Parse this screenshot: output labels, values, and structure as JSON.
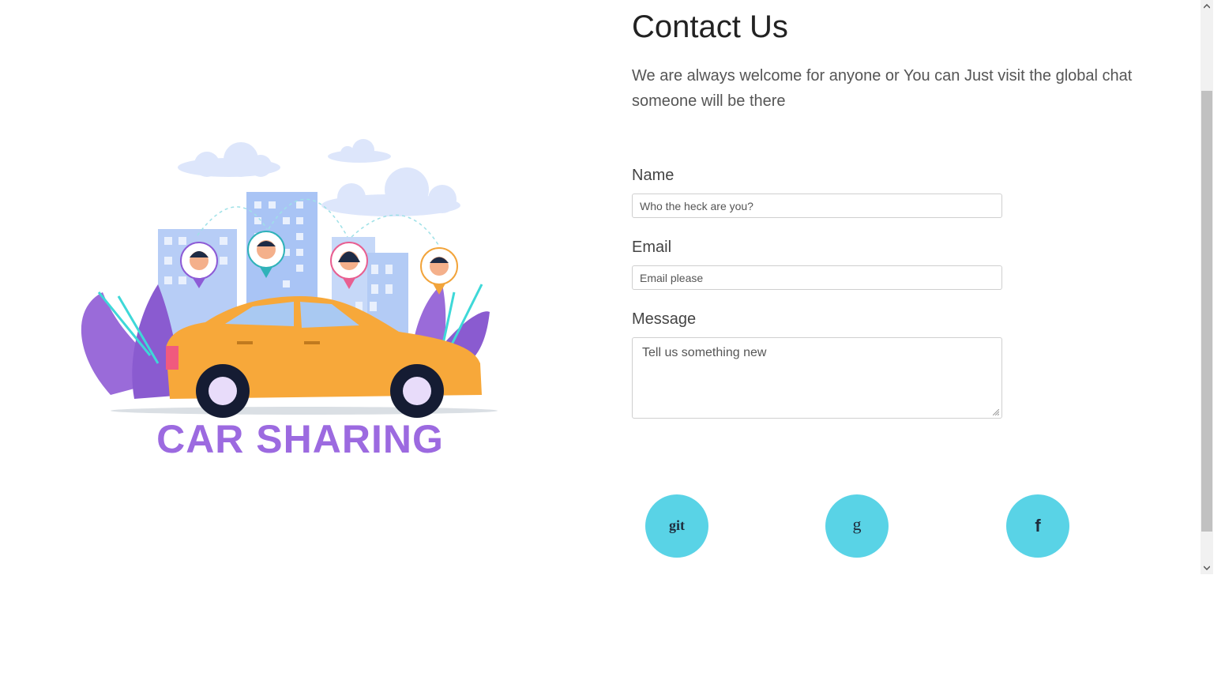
{
  "page": {
    "title": "Contact Us",
    "subtitle": "We are always welcome for anyone or You can Just visit the global chat someone will be there"
  },
  "illustration": {
    "banner_text": "CAR SHARING"
  },
  "form": {
    "name_label": "Name",
    "name_placeholder": "Who the heck are you?",
    "email_label": "Email",
    "email_placeholder": "Email please",
    "message_label": "Message",
    "message_placeholder": "Tell us something new"
  },
  "social": [
    {
      "icon": "github-icon",
      "label": "git"
    },
    {
      "icon": "google-icon",
      "label": "g"
    },
    {
      "icon": "facebook-icon",
      "label": "f"
    }
  ],
  "colors": {
    "accent": "#59d3e6",
    "banner": "#9c6ae0",
    "car": "#f7a83a"
  }
}
